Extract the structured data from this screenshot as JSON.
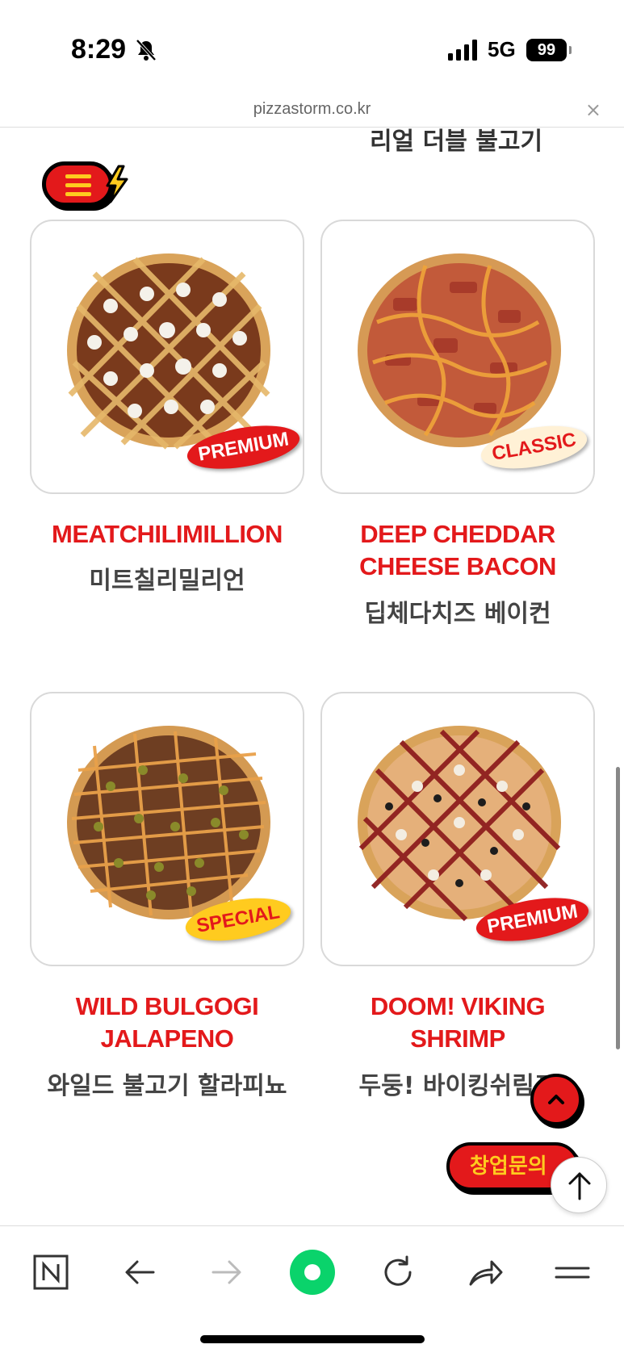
{
  "status_bar": {
    "time": "8:29",
    "network": "5G",
    "battery": "99",
    "icons": [
      "bell-muted-icon",
      "signal-icon"
    ]
  },
  "browser": {
    "url": "pizzastorm.co.kr",
    "close_icon": "×"
  },
  "partial_title": "리얼 더블 불고기",
  "products": [
    {
      "name_en": "MEATCHILIMILLION",
      "name_ko": "미트칠리밀리언",
      "badge": "PREMIUM",
      "badge_type": "premium"
    },
    {
      "name_en": "DEEP CHEDDAR CHEESE BACON",
      "name_ko": "딥체다치즈 베이컨",
      "badge": "CLASSIC",
      "badge_type": "classic"
    },
    {
      "name_en": "WILD BULGOGI JALAPENO",
      "name_ko": "와일드 불고기 할라피뇨",
      "badge": "SPECIAL",
      "badge_type": "special"
    },
    {
      "name_en": "DOOM! VIKING SHRIMP",
      "name_ko": "두둥! 바이킹쉬림프",
      "badge": "PREMIUM",
      "badge_type": "premium"
    }
  ],
  "floating": {
    "consult_label": "창업문의"
  },
  "colors": {
    "brand_red": "#e3191b",
    "brand_yellow": "#ffcb1f",
    "classic_cream": "#fff1d6"
  },
  "toolbar_icons": [
    "naver-n-icon",
    "back-arrow-icon",
    "forward-arrow-icon",
    "green-dot-icon",
    "reload-icon",
    "share-icon",
    "menu-icon"
  ]
}
